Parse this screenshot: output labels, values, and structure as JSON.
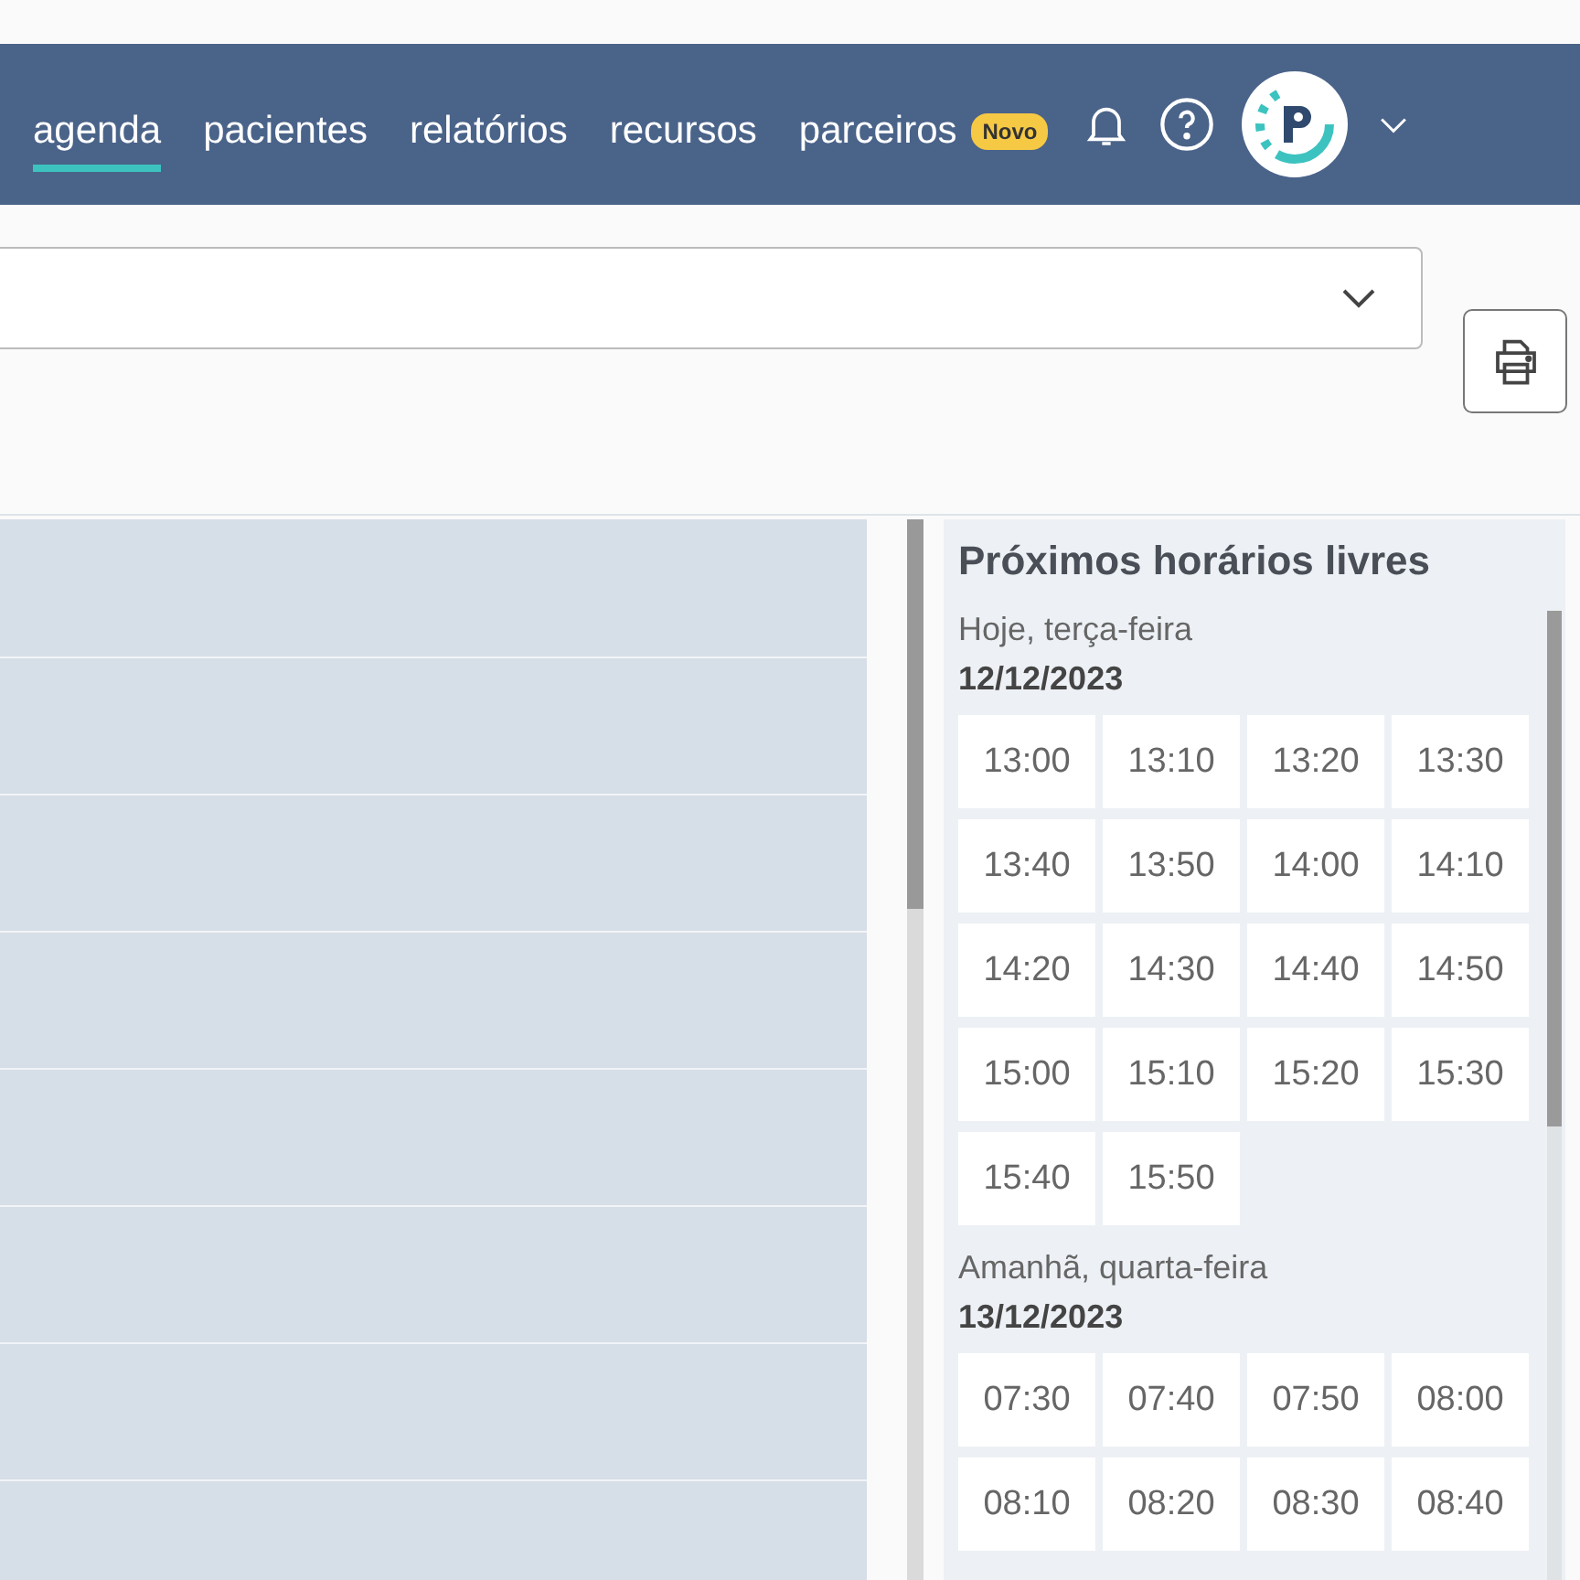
{
  "nav": {
    "tabs": [
      {
        "label": "agenda",
        "selected": true
      },
      {
        "label": "pacientes",
        "selected": false
      },
      {
        "label": "relatórios",
        "selected": false
      },
      {
        "label": "recursos",
        "selected": false
      },
      {
        "label": "parceiros",
        "selected": false,
        "badge": "Novo"
      }
    ]
  },
  "free_slots": {
    "title": "Próximos horários livres",
    "days": [
      {
        "label": "Hoje, terça-feira",
        "date": "12/12/2023",
        "times": [
          "13:00",
          "13:10",
          "13:20",
          "13:30",
          "13:40",
          "13:50",
          "14:00",
          "14:10",
          "14:20",
          "14:30",
          "14:40",
          "14:50",
          "15:00",
          "15:10",
          "15:20",
          "15:30",
          "15:40",
          "15:50"
        ]
      },
      {
        "label": "Amanhã, quarta-feira",
        "date": "13/12/2023",
        "times": [
          "07:30",
          "07:40",
          "07:50",
          "08:00",
          "08:10",
          "08:20",
          "08:30",
          "08:40"
        ]
      }
    ]
  }
}
